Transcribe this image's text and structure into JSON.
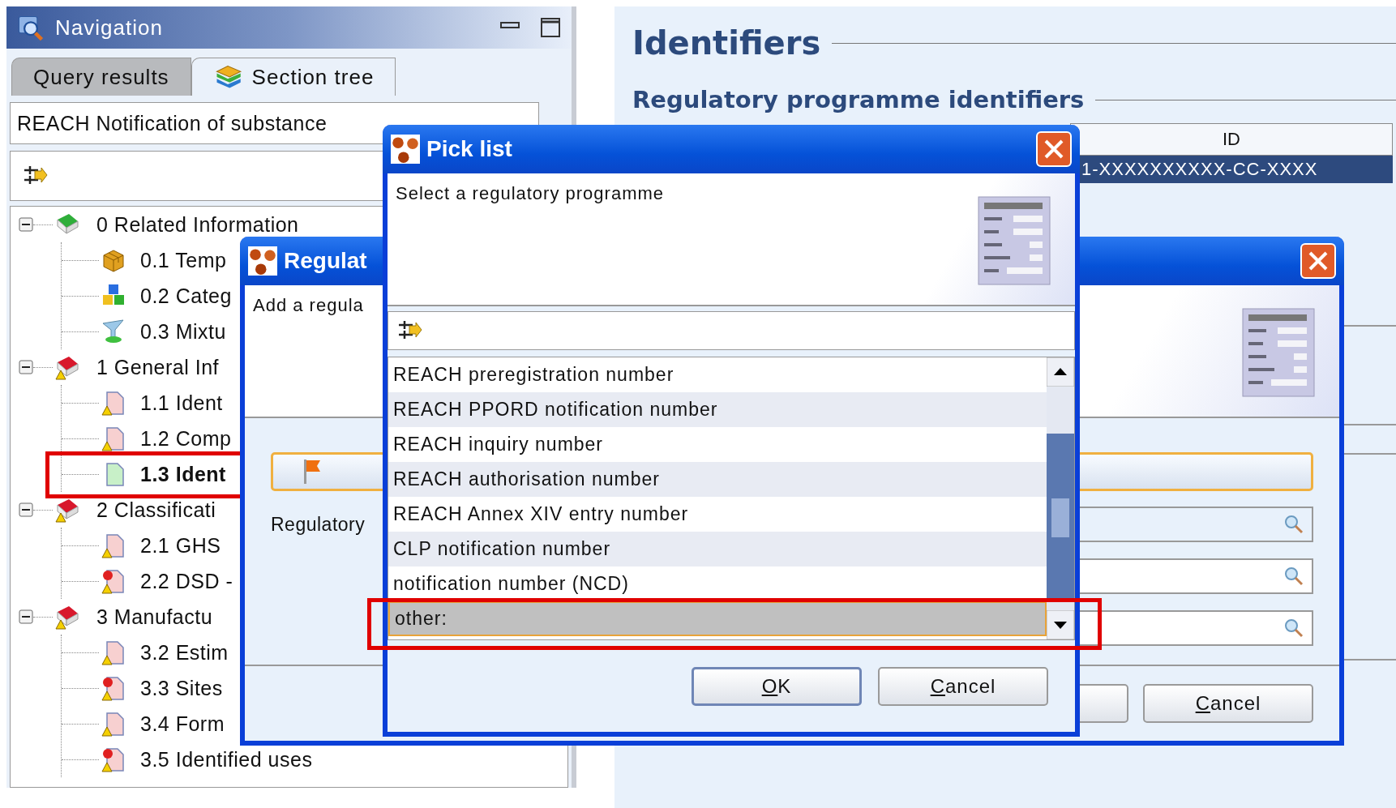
{
  "navigation": {
    "title": "Navigation",
    "tabs": [
      {
        "label": "Query results",
        "selected": false
      },
      {
        "label": "Section tree",
        "selected": true
      }
    ],
    "dossier_field": {
      "value": "REACH Notification of substance"
    },
    "tree": [
      {
        "label": "0 Related Information",
        "kind": "book",
        "warning": false,
        "error": false,
        "expanded": true,
        "selected": false,
        "highlighted": false,
        "children": [
          {
            "label": "0.1 Temp",
            "kind": "box",
            "warning": false,
            "error": false,
            "selected": false,
            "highlighted": false
          },
          {
            "label": "0.2 Categ",
            "kind": "cubes",
            "warning": false,
            "error": false,
            "selected": false,
            "highlighted": false
          },
          {
            "label": "0.3 Mixtu",
            "kind": "funnel",
            "warning": false,
            "error": false,
            "selected": false,
            "highlighted": false
          }
        ]
      },
      {
        "label": "1 General Inf",
        "kind": "book",
        "warning": true,
        "error": false,
        "expanded": true,
        "selected": false,
        "highlighted": false,
        "children": [
          {
            "label": "1.1 Ident",
            "kind": "page",
            "warning": true,
            "error": false,
            "selected": false,
            "highlighted": false
          },
          {
            "label": "1.2 Comp",
            "kind": "page",
            "warning": true,
            "error": false,
            "selected": false,
            "highlighted": false
          },
          {
            "label": "1.3 Ident",
            "kind": "page",
            "warning": false,
            "error": false,
            "selected": true,
            "highlighted": true
          }
        ]
      },
      {
        "label": "2 Classificati",
        "kind": "book",
        "warning": true,
        "error": false,
        "expanded": true,
        "selected": false,
        "highlighted": false,
        "children": [
          {
            "label": "2.1 GHS",
            "kind": "page",
            "warning": true,
            "error": false,
            "selected": false,
            "highlighted": false
          },
          {
            "label": "2.2 DSD -",
            "kind": "page",
            "warning": true,
            "error": true,
            "selected": false,
            "highlighted": false
          }
        ]
      },
      {
        "label": "3 Manufactu",
        "kind": "book",
        "warning": true,
        "error": false,
        "expanded": true,
        "selected": false,
        "highlighted": false,
        "children": [
          {
            "label": "3.2 Estim",
            "kind": "page",
            "warning": true,
            "error": false,
            "selected": false,
            "highlighted": false
          },
          {
            "label": "3.3 Sites",
            "kind": "page",
            "warning": true,
            "error": true,
            "selected": false,
            "highlighted": false
          },
          {
            "label": "3.4 Form",
            "kind": "page",
            "warning": true,
            "error": false,
            "selected": false,
            "highlighted": false
          },
          {
            "label": "3.5 Identified uses",
            "kind": "page",
            "warning": true,
            "error": true,
            "selected": false,
            "highlighted": false
          }
        ]
      }
    ]
  },
  "identifiers_panel": {
    "title": "Identifiers",
    "subtitle": "Regulatory programme identifiers",
    "table": {
      "columns": [
        "ID"
      ],
      "rows": [
        {
          "id": "1-XXXXXXXXXX-CC-XXXX",
          "selected": true
        }
      ]
    }
  },
  "regulatory_dialog": {
    "title": "Regulat",
    "instruction": "Add a regula",
    "field_label": "Regulatory",
    "buttons": [
      {
        "label": "Cancel",
        "default": false
      }
    ]
  },
  "pick_list": {
    "title": "Pick list",
    "instruction": "Select a regulatory programme",
    "items": [
      {
        "label": "REACH preregistration number",
        "selected": false,
        "highlighted": false
      },
      {
        "label": "REACH PPORD notification number",
        "selected": false,
        "highlighted": false
      },
      {
        "label": "REACH inquiry number",
        "selected": false,
        "highlighted": false
      },
      {
        "label": "REACH authorisation number",
        "selected": false,
        "highlighted": false
      },
      {
        "label": "REACH Annex XIV entry number",
        "selected": false,
        "highlighted": false
      },
      {
        "label": "CLP notification number",
        "selected": false,
        "highlighted": false
      },
      {
        "label": "notification number (NCD)",
        "selected": false,
        "highlighted": false
      },
      {
        "label": "other:",
        "selected": true,
        "highlighted": true
      }
    ],
    "buttons": [
      {
        "label": "OK",
        "default": true
      },
      {
        "label": "Cancel",
        "default": false
      }
    ]
  }
}
